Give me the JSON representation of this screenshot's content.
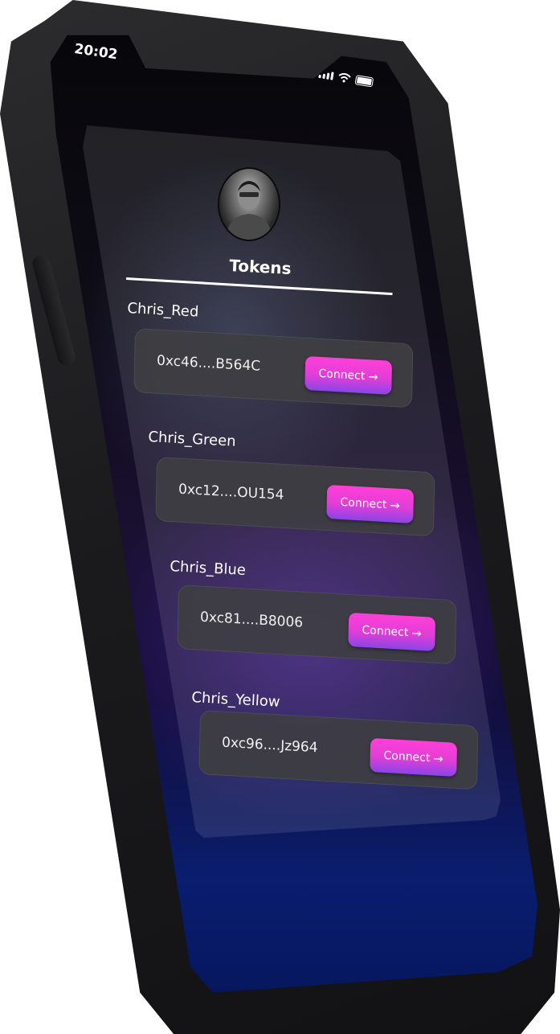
{
  "status_bar": {
    "time": "20:02"
  },
  "page": {
    "title": "Tokens"
  },
  "tokens": [
    {
      "name": "Chris_Red",
      "address": "0xc46....B564C",
      "button": "Connect"
    },
    {
      "name": "Chris_Green",
      "address": "0xc12....OU154",
      "button": "Connect"
    },
    {
      "name": "Chris_Blue",
      "address": "0xc81....B8006",
      "button": "Connect"
    },
    {
      "name": "Chris_Yellow",
      "address": "0xc96....Jz964",
      "button": "Connect"
    }
  ],
  "icons": {
    "arrow": "arrow-right-icon",
    "signal": "signal-icon",
    "wifi": "wifi-icon",
    "battery": "battery-icon"
  },
  "colors": {
    "button_top": "#ff3fd8",
    "button_bottom": "#8a44e8",
    "screen_bottom": "#05155a"
  }
}
